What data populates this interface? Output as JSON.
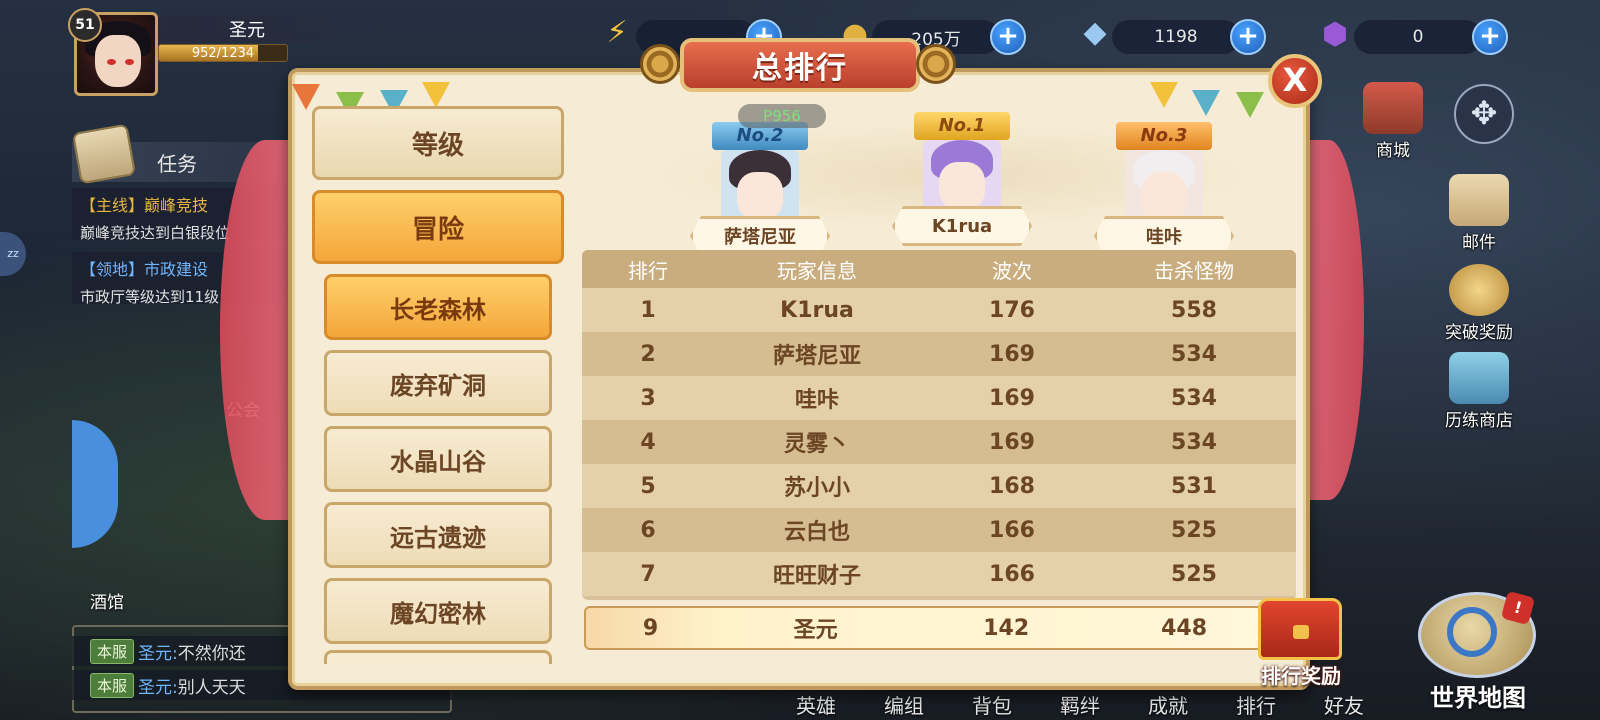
{
  "player": {
    "level": "51",
    "name": "圣元",
    "xp_text": "952/1234",
    "xp_fraction": 0.77
  },
  "resources": [
    {
      "icon": "energy-icon",
      "value": ""
    },
    {
      "icon": "gold-coin-icon",
      "value": "205万"
    },
    {
      "icon": "diamond-icon",
      "value": "1198"
    },
    {
      "icon": "crystal-icon",
      "value": "0"
    }
  ],
  "tasks": {
    "tab_label": "任务",
    "items": [
      {
        "tag": "【主线】",
        "name": "巅峰竞技",
        "desc": "巅峰竞技达到白银段位"
      },
      {
        "tag": "【领地】",
        "name": "市政建设",
        "desc": "市政厅等级达到11级"
      }
    ]
  },
  "side_circle_label": "zz",
  "map_labels": {
    "guild": "公会",
    "tavern": "酒馆"
  },
  "chat": [
    {
      "tag": "本服",
      "who": "圣元:",
      "text": "不然你还"
    },
    {
      "tag": "本服",
      "who": "圣元:",
      "text": "别人天天"
    }
  ],
  "right_menu": [
    {
      "id": "shop",
      "label": "商城"
    },
    {
      "id": "mail",
      "label": "邮件"
    },
    {
      "id": "breakthrough",
      "label": "突破奖励"
    },
    {
      "id": "training-shop",
      "label": "历练商店"
    }
  ],
  "world_map_label": "世界地图",
  "alert_mark": "!",
  "bottom_nav": [
    "英雄",
    "编组",
    "背包",
    "羁绊",
    "成就",
    "排行",
    "好友"
  ],
  "dialog": {
    "title": "总排行",
    "close_symbol": "X",
    "categories": [
      {
        "label": "等级",
        "active": false
      },
      {
        "label": "冒险",
        "active": true
      }
    ],
    "subcategories": [
      {
        "label": "长老森林",
        "active": true
      },
      {
        "label": "废弃矿洞",
        "active": false
      },
      {
        "label": "水晶山谷",
        "active": false
      },
      {
        "label": "远古遗迹",
        "active": false
      },
      {
        "label": "魔幻密林",
        "active": false
      }
    ],
    "overlay_id": "P956",
    "podium": [
      {
        "rank_label": "No.2",
        "name": "萨塔尼亚"
      },
      {
        "rank_label": "No.1",
        "name": "K1rua"
      },
      {
        "rank_label": "No.3",
        "name": "哇咔"
      }
    ],
    "table": {
      "headers": [
        "排行",
        "玩家信息",
        "波次",
        "击杀怪物"
      ],
      "rows": [
        {
          "rank": "1",
          "name": "K1rua",
          "wave": "176",
          "kills": "558"
        },
        {
          "rank": "2",
          "name": "萨塔尼亚",
          "wave": "169",
          "kills": "534"
        },
        {
          "rank": "3",
          "name": "哇咔",
          "wave": "169",
          "kills": "534"
        },
        {
          "rank": "4",
          "name": "灵雾丶",
          "wave": "169",
          "kills": "534"
        },
        {
          "rank": "5",
          "name": "苏小小",
          "wave": "168",
          "kills": "531"
        },
        {
          "rank": "6",
          "name": "云白也",
          "wave": "166",
          "kills": "525"
        },
        {
          "rank": "7",
          "name": "旺旺财子",
          "wave": "166",
          "kills": "525"
        }
      ]
    },
    "my_row": {
      "rank": "9",
      "name": "圣元",
      "wave": "142",
      "kills": "448"
    },
    "reward_label": "排行奖励"
  }
}
